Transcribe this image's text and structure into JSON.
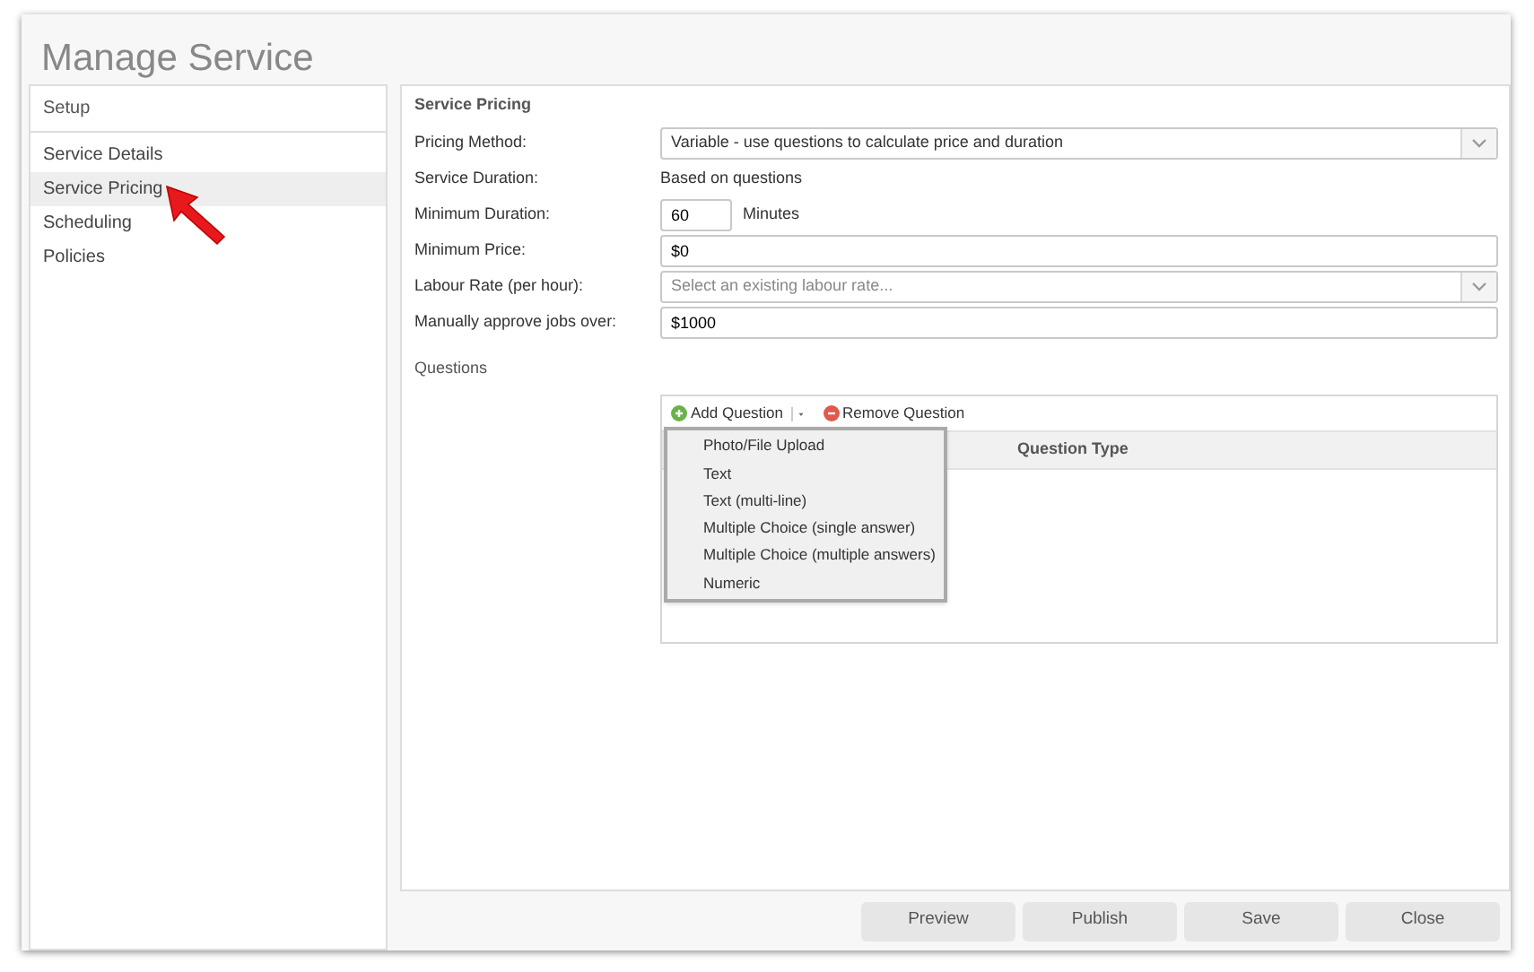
{
  "window": {
    "title": "Manage Service"
  },
  "sidebar": {
    "header": "Setup",
    "items": [
      {
        "label": "Service Details",
        "selected": false
      },
      {
        "label": "Service Pricing",
        "selected": true
      },
      {
        "label": "Scheduling",
        "selected": false
      },
      {
        "label": "Policies",
        "selected": false
      }
    ]
  },
  "panel": {
    "title": "Service Pricing",
    "fields": [
      {
        "kind": "select",
        "label": "Pricing Method:",
        "value": "Variable - use questions to calculate price and duration"
      },
      {
        "kind": "static",
        "label": "Service Duration:",
        "value": "Based on questions"
      },
      {
        "kind": "unit",
        "label": "Minimum Duration:",
        "value": "60",
        "unit": "Minutes"
      },
      {
        "kind": "input",
        "label": "Minimum Price:",
        "value": "$0"
      },
      {
        "kind": "select",
        "label": "Labour Rate (per hour):",
        "placeholder": "Select an existing labour rate..."
      },
      {
        "kind": "input",
        "label": "Manually approve jobs over:",
        "value": "$1000"
      }
    ]
  },
  "questions": {
    "title": "Questions",
    "toolbar": {
      "add": "Add Question",
      "remove": "Remove Question"
    },
    "columns": [
      "Question Type"
    ],
    "menu": [
      "Photo/File Upload",
      "Text",
      "Text (multi-line)",
      "Multiple Choice (single answer)",
      "Multiple Choice (multiple answers)",
      "Numeric"
    ]
  },
  "buttons": [
    "Preview",
    "Publish",
    "Save",
    "Close"
  ]
}
